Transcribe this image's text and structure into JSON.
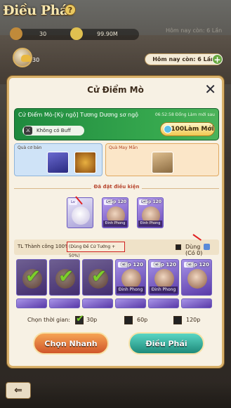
{
  "header": {
    "title": "Điều Phái",
    "help_icon": "?"
  },
  "resources": [
    {
      "name": "res-1",
      "value": "30"
    },
    {
      "name": "res-2",
      "value": "99.90M"
    }
  ],
  "faded_remaining": "Hôm nay còn: 6 Lần",
  "ingot": {
    "value": "30"
  },
  "remaining": {
    "label": "Hôm nay còn: 6 Lần"
  },
  "modal": {
    "title": "Cử Điểm Mò",
    "close_icon": "✕",
    "banner": {
      "name": "Cử Điểm Mò-[Kỳ ngộ] Tương Dương sơ ngộ",
      "time": "06:52:58 Đổng Làm mới sau",
      "buff": "Không có Buff",
      "refresh_button": "100Làm Mới"
    },
    "rewards": {
      "base_label": "Quà cơ bản",
      "luck_label": "Quà May Mắn"
    },
    "assigned_label": "Đã đặt điều kiện",
    "assigned_cards": [
      {
        "level": "Lv",
        "cap": "",
        "tag": ""
      },
      {
        "level": "Lv",
        "cap": "Cấp 120",
        "tag": "Đinh Phong"
      },
      {
        "level": "Lv",
        "cap": "Cấp 120",
        "tag": "Đinh Phong"
      }
    ],
    "success_rate": "TL Thành công 100%",
    "bonus": "(Dùng Đề Cử Tướng + 50%)",
    "use_label": "Dùng",
    "use_count": "(Có 0)",
    "hero_grid": [
      {
        "checked": true,
        "cap": "",
        "tag": ""
      },
      {
        "checked": true,
        "cap": "",
        "tag": ""
      },
      {
        "checked": true,
        "cap": "",
        "tag": ""
      },
      {
        "checked": false,
        "cap": "Cấp 120",
        "tag": "Đinh Phong"
      },
      {
        "checked": false,
        "cap": "Cấp 120",
        "tag": "Đinh Phong"
      },
      {
        "checked": false,
        "cap": "Cấp 120",
        "tag": ""
      }
    ],
    "time_label": "Chọn thời gian:",
    "time_options": [
      {
        "label": "30p",
        "selected": true
      },
      {
        "label": "60p",
        "selected": false
      },
      {
        "label": "120p",
        "selected": false
      }
    ],
    "quick_button": "Chọn Nhanh",
    "dispatch_button": "Điều Phái"
  },
  "back_icon": "⇐",
  "colors": {
    "banner": "#2f9a48",
    "quick_button": "#e07a3a",
    "dispatch_button": "#2aa898",
    "modal_border": "#d9b16a"
  }
}
